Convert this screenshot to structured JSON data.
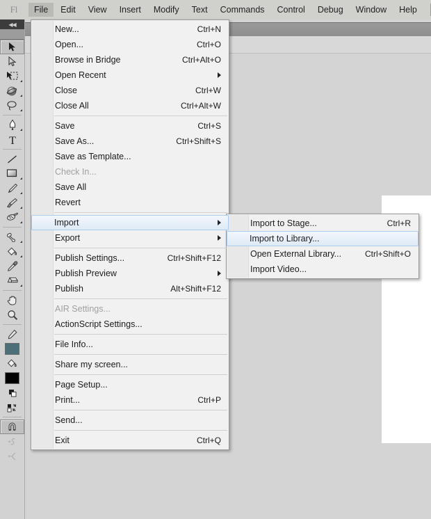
{
  "app": {
    "logo": "Fl",
    "stage_bg": "#ffffff",
    "accent": "#a8cdee",
    "chrome_bg": "#d4d4d4"
  },
  "menubar": {
    "items": [
      {
        "label": "File",
        "name": "menubar-item-file",
        "active": true
      },
      {
        "label": "Edit",
        "name": "menubar-item-edit",
        "active": false
      },
      {
        "label": "View",
        "name": "menubar-item-view",
        "active": false
      },
      {
        "label": "Insert",
        "name": "menubar-item-insert",
        "active": false
      },
      {
        "label": "Modify",
        "name": "menubar-item-modify",
        "active": false
      },
      {
        "label": "Text",
        "name": "menubar-item-text",
        "active": false
      },
      {
        "label": "Commands",
        "name": "menubar-item-commands",
        "active": false
      },
      {
        "label": "Control",
        "name": "menubar-item-control",
        "active": false
      },
      {
        "label": "Debug",
        "name": "menubar-item-debug",
        "active": false
      },
      {
        "label": "Window",
        "name": "menubar-item-window",
        "active": false
      },
      {
        "label": "Help",
        "name": "menubar-item-help",
        "active": false
      }
    ]
  },
  "toolbar": {
    "collapse_glyph": "◀◀",
    "tools": [
      {
        "name": "selection-tool-icon",
        "selected": true
      },
      {
        "name": "subselection-tool-icon",
        "selected": false
      },
      {
        "name": "free-transform-tool-icon",
        "selected": false
      },
      {
        "name": "3d-rotation-tool-icon",
        "selected": false
      },
      {
        "name": "lasso-tool-icon",
        "selected": false
      },
      {
        "name": "pen-tool-icon",
        "selected": false
      },
      {
        "name": "text-tool-icon",
        "selected": false
      },
      {
        "name": "line-tool-icon",
        "selected": false
      },
      {
        "name": "rectangle-tool-icon",
        "selected": false
      },
      {
        "name": "pencil-tool-icon",
        "selected": false
      },
      {
        "name": "brush-tool-icon",
        "selected": false
      },
      {
        "name": "spray-brush-tool-icon",
        "selected": false
      },
      {
        "name": "bone-tool-icon",
        "selected": false
      },
      {
        "name": "paint-bucket-tool-icon",
        "selected": false
      },
      {
        "name": "eyedropper-tool-icon",
        "selected": false
      },
      {
        "name": "eraser-tool-icon",
        "selected": false
      },
      {
        "name": "hand-tool-icon",
        "selected": false
      },
      {
        "name": "zoom-tool-icon",
        "selected": false
      }
    ],
    "colors": {
      "stroke_label": "stroke-color-swatch",
      "stroke_color": "#4d7078",
      "fill_label": "fill-color-swatch",
      "fill_color": "#000000"
    },
    "options": [
      {
        "name": "snap-to-objects-icon",
        "selected": true,
        "disabled": false
      },
      {
        "name": "smooth-option-icon",
        "selected": false,
        "disabled": true
      },
      {
        "name": "straighten-option-icon",
        "selected": false,
        "disabled": true
      }
    ]
  },
  "file_menu": {
    "name": "file-dropdown-menu",
    "items": [
      {
        "type": "item",
        "label": "New...",
        "accel": "Ctrl+N",
        "name": "menu-item-new"
      },
      {
        "type": "item",
        "label": "Open...",
        "accel": "Ctrl+O",
        "name": "menu-item-open"
      },
      {
        "type": "item",
        "label": "Browse in Bridge",
        "accel": "Ctrl+Alt+O",
        "name": "menu-item-browse-in-bridge"
      },
      {
        "type": "item",
        "label": "Open Recent",
        "accel": "",
        "submenu": true,
        "name": "menu-item-open-recent"
      },
      {
        "type": "item",
        "label": "Close",
        "accel": "Ctrl+W",
        "name": "menu-item-close"
      },
      {
        "type": "item",
        "label": "Close All",
        "accel": "Ctrl+Alt+W",
        "name": "menu-item-close-all"
      },
      {
        "type": "sep",
        "name": "menu-separator"
      },
      {
        "type": "item",
        "label": "Save",
        "accel": "Ctrl+S",
        "name": "menu-item-save"
      },
      {
        "type": "item",
        "label": "Save As...",
        "accel": "Ctrl+Shift+S",
        "name": "menu-item-save-as"
      },
      {
        "type": "item",
        "label": "Save as Template...",
        "accel": "",
        "name": "menu-item-save-as-template"
      },
      {
        "type": "item",
        "label": "Check In...",
        "accel": "",
        "disabled": true,
        "name": "menu-item-check-in"
      },
      {
        "type": "item",
        "label": "Save All",
        "accel": "",
        "name": "menu-item-save-all"
      },
      {
        "type": "item",
        "label": "Revert",
        "accel": "",
        "name": "menu-item-revert"
      },
      {
        "type": "sep",
        "name": "menu-separator"
      },
      {
        "type": "item",
        "label": "Import",
        "accel": "",
        "submenu": true,
        "highlighted": true,
        "name": "menu-item-import"
      },
      {
        "type": "item",
        "label": "Export",
        "accel": "",
        "submenu": true,
        "name": "menu-item-export"
      },
      {
        "type": "sep",
        "name": "menu-separator"
      },
      {
        "type": "item",
        "label": "Publish Settings...",
        "accel": "Ctrl+Shift+F12",
        "name": "menu-item-publish-settings"
      },
      {
        "type": "item",
        "label": "Publish Preview",
        "accel": "",
        "submenu": true,
        "name": "menu-item-publish-preview"
      },
      {
        "type": "item",
        "label": "Publish",
        "accel": "Alt+Shift+F12",
        "name": "menu-item-publish"
      },
      {
        "type": "sep",
        "name": "menu-separator"
      },
      {
        "type": "item",
        "label": "AIR Settings...",
        "accel": "",
        "disabled": true,
        "name": "menu-item-air-settings"
      },
      {
        "type": "item",
        "label": "ActionScript Settings...",
        "accel": "",
        "name": "menu-item-actionscript-settings"
      },
      {
        "type": "sep",
        "name": "menu-separator"
      },
      {
        "type": "item",
        "label": "File Info...",
        "accel": "",
        "name": "menu-item-file-info"
      },
      {
        "type": "sep",
        "name": "menu-separator"
      },
      {
        "type": "item",
        "label": "Share my screen...",
        "accel": "",
        "name": "menu-item-share-my-screen"
      },
      {
        "type": "sep",
        "name": "menu-separator"
      },
      {
        "type": "item",
        "label": "Page Setup...",
        "accel": "",
        "name": "menu-item-page-setup"
      },
      {
        "type": "item",
        "label": "Print...",
        "accel": "Ctrl+P",
        "name": "menu-item-print"
      },
      {
        "type": "sep",
        "name": "menu-separator"
      },
      {
        "type": "item",
        "label": "Send...",
        "accel": "",
        "name": "menu-item-send"
      },
      {
        "type": "sep",
        "name": "menu-separator"
      },
      {
        "type": "item",
        "label": "Exit",
        "accel": "Ctrl+Q",
        "name": "menu-item-exit"
      }
    ]
  },
  "import_menu": {
    "name": "import-submenu",
    "items": [
      {
        "type": "item",
        "label": "Import to Stage...",
        "accel": "Ctrl+R",
        "name": "menu-item-import-to-stage"
      },
      {
        "type": "item",
        "label": "Import to Library...",
        "accel": "",
        "highlighted": true,
        "name": "menu-item-import-to-library"
      },
      {
        "type": "item",
        "label": "Open External Library...",
        "accel": "Ctrl+Shift+O",
        "name": "menu-item-open-external-library"
      },
      {
        "type": "item",
        "label": "Import Video...",
        "accel": "",
        "name": "menu-item-import-video"
      }
    ]
  }
}
